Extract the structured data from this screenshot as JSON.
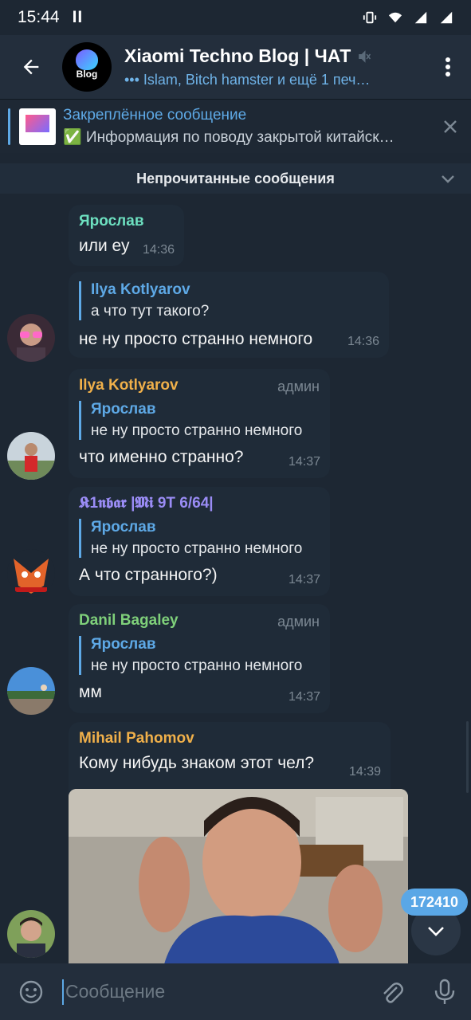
{
  "status_bar": {
    "time": "15:44",
    "pause": "II"
  },
  "header": {
    "title": "Xiaomi Techno Blog | ЧАТ",
    "subtitle": "••• Islam, Bitch hamster и ещё 1 печ…",
    "avatar_text": "Blog"
  },
  "pinned": {
    "title": "Закреплённое сообщение",
    "body": "✅ Информация по поводу закрытой китайск…"
  },
  "unread_banner": "Непрочитанные сообщения",
  "messages": [
    {
      "sender": "Ярослав",
      "text": "или еу",
      "time": "14:36",
      "sender_color": "#6de0c0"
    },
    {
      "reply_name": "Ilya Kotlyarov",
      "reply_text": "а что тут такого?",
      "text": "не ну просто странно немного",
      "time": "14:36"
    },
    {
      "sender": "Ilya Kotlyarov",
      "admin": "админ",
      "reply_name": "Ярослав",
      "reply_text": "не ну просто странно немного",
      "text": "что именно странно?",
      "time": "14:37",
      "sender_color": "#f0b04a"
    },
    {
      "sender": "𝕶1𝖓𝖇𝖆𝖗 |𝕸𝖎 9T 6/64|",
      "reply_name": "Ярослав",
      "reply_text": "не ну просто странно немного",
      "text": "А что странного?)",
      "time": "14:37",
      "sender_color": "#9a8cf5"
    },
    {
      "sender": "Danil Bagaley",
      "admin": "админ",
      "reply_name": "Ярослав",
      "reply_text": "не ну просто странно немного",
      "text": "мм",
      "time": "14:37",
      "sender_color": "#7fd07a"
    },
    {
      "sender": "Mihail Pahomov",
      "text": "Кому нибудь знаком этот чел?",
      "time": "14:39",
      "sender_color": "#f0b04a"
    }
  ],
  "unread_count": "172410",
  "input": {
    "placeholder": "Сообщение"
  },
  "colors": {
    "background": "#1d2733",
    "header": "#232e3c",
    "bubble": "#1f2b38",
    "accent": "#5ea9e6"
  }
}
